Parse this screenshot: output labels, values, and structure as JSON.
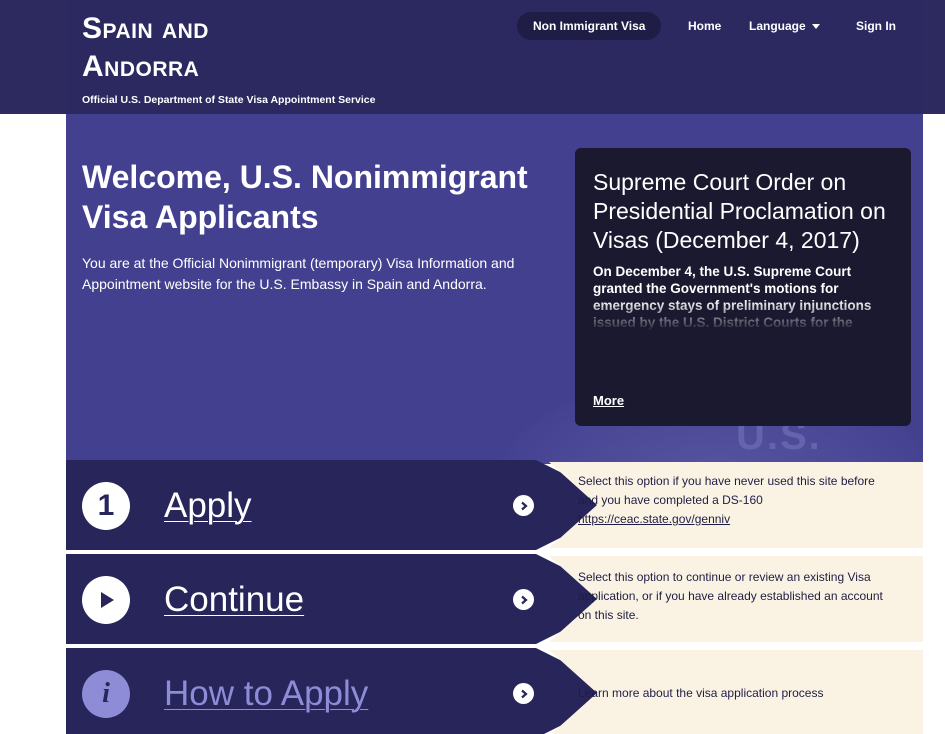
{
  "header": {
    "country_line1": "Spain and",
    "country_line2": "Andorra",
    "subtitle": "Official U.S. Department of State Visa Appointment Service",
    "nav": {
      "active": "Non Immigrant Visa",
      "home": "Home",
      "language": "Language",
      "signin": "Sign In"
    }
  },
  "hero": {
    "title": "Welcome, U.S. Nonimmigrant Visa Applicants",
    "text": "You are at the Official Nonimmigrant (temporary) Visa Information and Appointment website for the U.S. Embassy in Spain and Andorra.",
    "seal_text": "U.S. VISA"
  },
  "news": {
    "title": "Supreme Court Order on Presidential Proclamation on Visas (December 4, 2017)",
    "body": "On December 4, the U.S. Supreme Court granted the Government's motions for emergency stays of preliminary injunctions issued by the U.S. District Courts for the",
    "more": "More"
  },
  "options": [
    {
      "label": "Apply",
      "icon": "number-one-icon",
      "icon_char": "1",
      "desc": "Select this option if you have never used this site before and you have completed a DS-160",
      "link": "https://ceac.state.gov/genniv"
    },
    {
      "label": "Continue",
      "icon": "play-icon",
      "desc": "Select this option to continue or review an existing Visa application, or if you have already established an account on this site."
    },
    {
      "label": "How to Apply",
      "icon": "info-icon",
      "icon_char": "i",
      "desc": "Learn more about the visa application process"
    }
  ],
  "colors": {
    "header_bg": "#2b2960",
    "hero_bg": "#43418f",
    "option_bg": "#27255a",
    "info_bg": "#faf3e3",
    "howto_accent": "#8e8cd6"
  }
}
